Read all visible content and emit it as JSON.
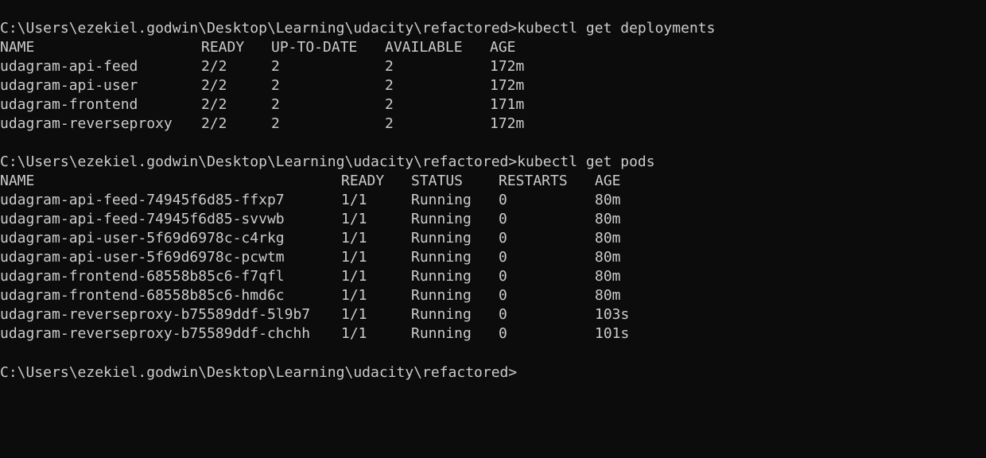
{
  "terminal": {
    "prompt": "C:\\Users\\ezekiel.godwin\\Desktop\\Learning\\udacity\\refactored>",
    "commands": {
      "deployments": "kubectl get deployments",
      "pods": "kubectl get pods"
    },
    "deployments": {
      "headers": {
        "name": "NAME",
        "ready": "READY",
        "up_to_date": "UP-TO-DATE",
        "available": "AVAILABLE",
        "age": "AGE"
      },
      "rows": [
        {
          "name": "udagram-api-feed",
          "ready": "2/2",
          "up_to_date": "2",
          "available": "2",
          "age": "172m"
        },
        {
          "name": "udagram-api-user",
          "ready": "2/2",
          "up_to_date": "2",
          "available": "2",
          "age": "172m"
        },
        {
          "name": "udagram-frontend",
          "ready": "2/2",
          "up_to_date": "2",
          "available": "2",
          "age": "171m"
        },
        {
          "name": "udagram-reverseproxy",
          "ready": "2/2",
          "up_to_date": "2",
          "available": "2",
          "age": "172m"
        }
      ]
    },
    "pods": {
      "headers": {
        "name": "NAME",
        "ready": "READY",
        "status": "STATUS",
        "restarts": "RESTARTS",
        "age": "AGE"
      },
      "rows": [
        {
          "name": "udagram-api-feed-74945f6d85-ffxp7",
          "ready": "1/1",
          "status": "Running",
          "restarts": "0",
          "age": "80m"
        },
        {
          "name": "udagram-api-feed-74945f6d85-svvwb",
          "ready": "1/1",
          "status": "Running",
          "restarts": "0",
          "age": "80m"
        },
        {
          "name": "udagram-api-user-5f69d6978c-c4rkg",
          "ready": "1/1",
          "status": "Running",
          "restarts": "0",
          "age": "80m"
        },
        {
          "name": "udagram-api-user-5f69d6978c-pcwtm",
          "ready": "1/1",
          "status": "Running",
          "restarts": "0",
          "age": "80m"
        },
        {
          "name": "udagram-frontend-68558b85c6-f7qfl",
          "ready": "1/1",
          "status": "Running",
          "restarts": "0",
          "age": "80m"
        },
        {
          "name": "udagram-frontend-68558b85c6-hmd6c",
          "ready": "1/1",
          "status": "Running",
          "restarts": "0",
          "age": "80m"
        },
        {
          "name": "udagram-reverseproxy-b75589ddf-5l9b7",
          "ready": "1/1",
          "status": "Running",
          "restarts": "0",
          "age": "103s"
        },
        {
          "name": "udagram-reverseproxy-b75589ddf-chchh",
          "ready": "1/1",
          "status": "Running",
          "restarts": "0",
          "age": "101s"
        }
      ]
    }
  },
  "colors": {
    "background": "#0c0c0c",
    "foreground": "#cccccc"
  }
}
